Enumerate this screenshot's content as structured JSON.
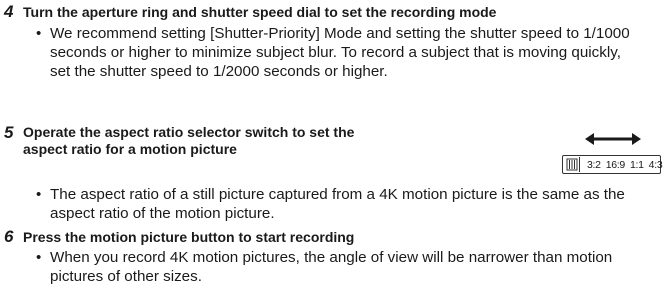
{
  "steps": [
    {
      "number": "4",
      "title": "Turn the aperture ring and shutter speed dial to set the recording mode",
      "bullets": [
        "We recommend setting [Shutter-Priority] Mode and setting the shutter speed to 1/1000 seconds or higher to minimize subject blur. To record a subject that is moving quickly, set the shutter speed to 1/2000 seconds or higher."
      ]
    },
    {
      "number": "5",
      "title": "Operate the aspect ratio selector switch to set the aspect ratio for a motion picture",
      "bullets": [
        "The aspect ratio of a still picture captured from a 4K motion picture is the same as the aspect ratio of the motion picture."
      ]
    },
    {
      "number": "6",
      "title": "Press the motion picture button to start recording",
      "bullets": [
        "When you record 4K motion pictures, the angle of view will be narrower than motion pictures of other sizes."
      ]
    }
  ],
  "bullet_char": "•",
  "selector": {
    "labels": [
      "3:2",
      "16:9",
      "1:1",
      "4:3"
    ],
    "arrow_icon": "double-headed-arrow-icon"
  }
}
